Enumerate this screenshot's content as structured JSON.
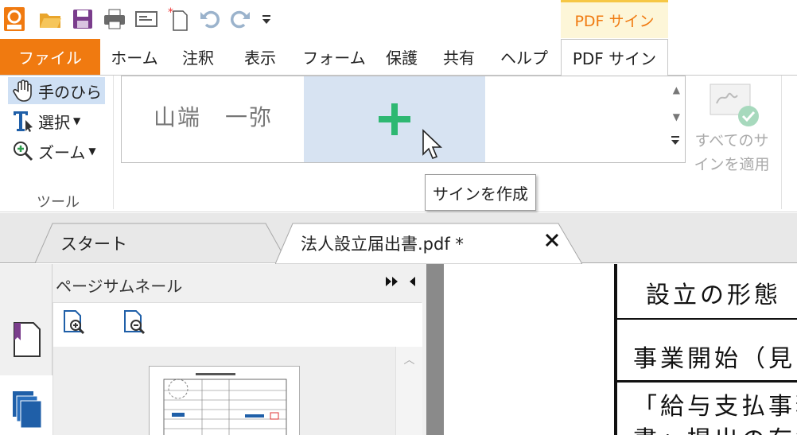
{
  "context_group": {
    "label": "PDF サイン"
  },
  "tabs": {
    "file": "ファイル",
    "items": [
      "ホーム",
      "注釈",
      "表示",
      "フォーム",
      "保護",
      "共有",
      "ヘルプ",
      "PDF サイン"
    ]
  },
  "tools": {
    "hand": "手のひら",
    "select": "選択",
    "zoom": "ズーム",
    "group_label": "ツール"
  },
  "signature": {
    "name": "山端　一弥",
    "tooltip": "サインを作成"
  },
  "apply": {
    "line1": "すべてのサ",
    "line2": "インを適用"
  },
  "doc_tabs": {
    "start": "スタート",
    "file": "法人設立届出書.pdf *"
  },
  "panel": {
    "title": "ページサムネール"
  },
  "document": {
    "line1": "設立の形態",
    "line2": "事業開始（見",
    "line3": "「給与支払事務",
    "line4": "書」提出の有無"
  },
  "colors": {
    "accent": "#f07a10",
    "selection": "#cfe0f4",
    "plus": "#2eb872"
  }
}
